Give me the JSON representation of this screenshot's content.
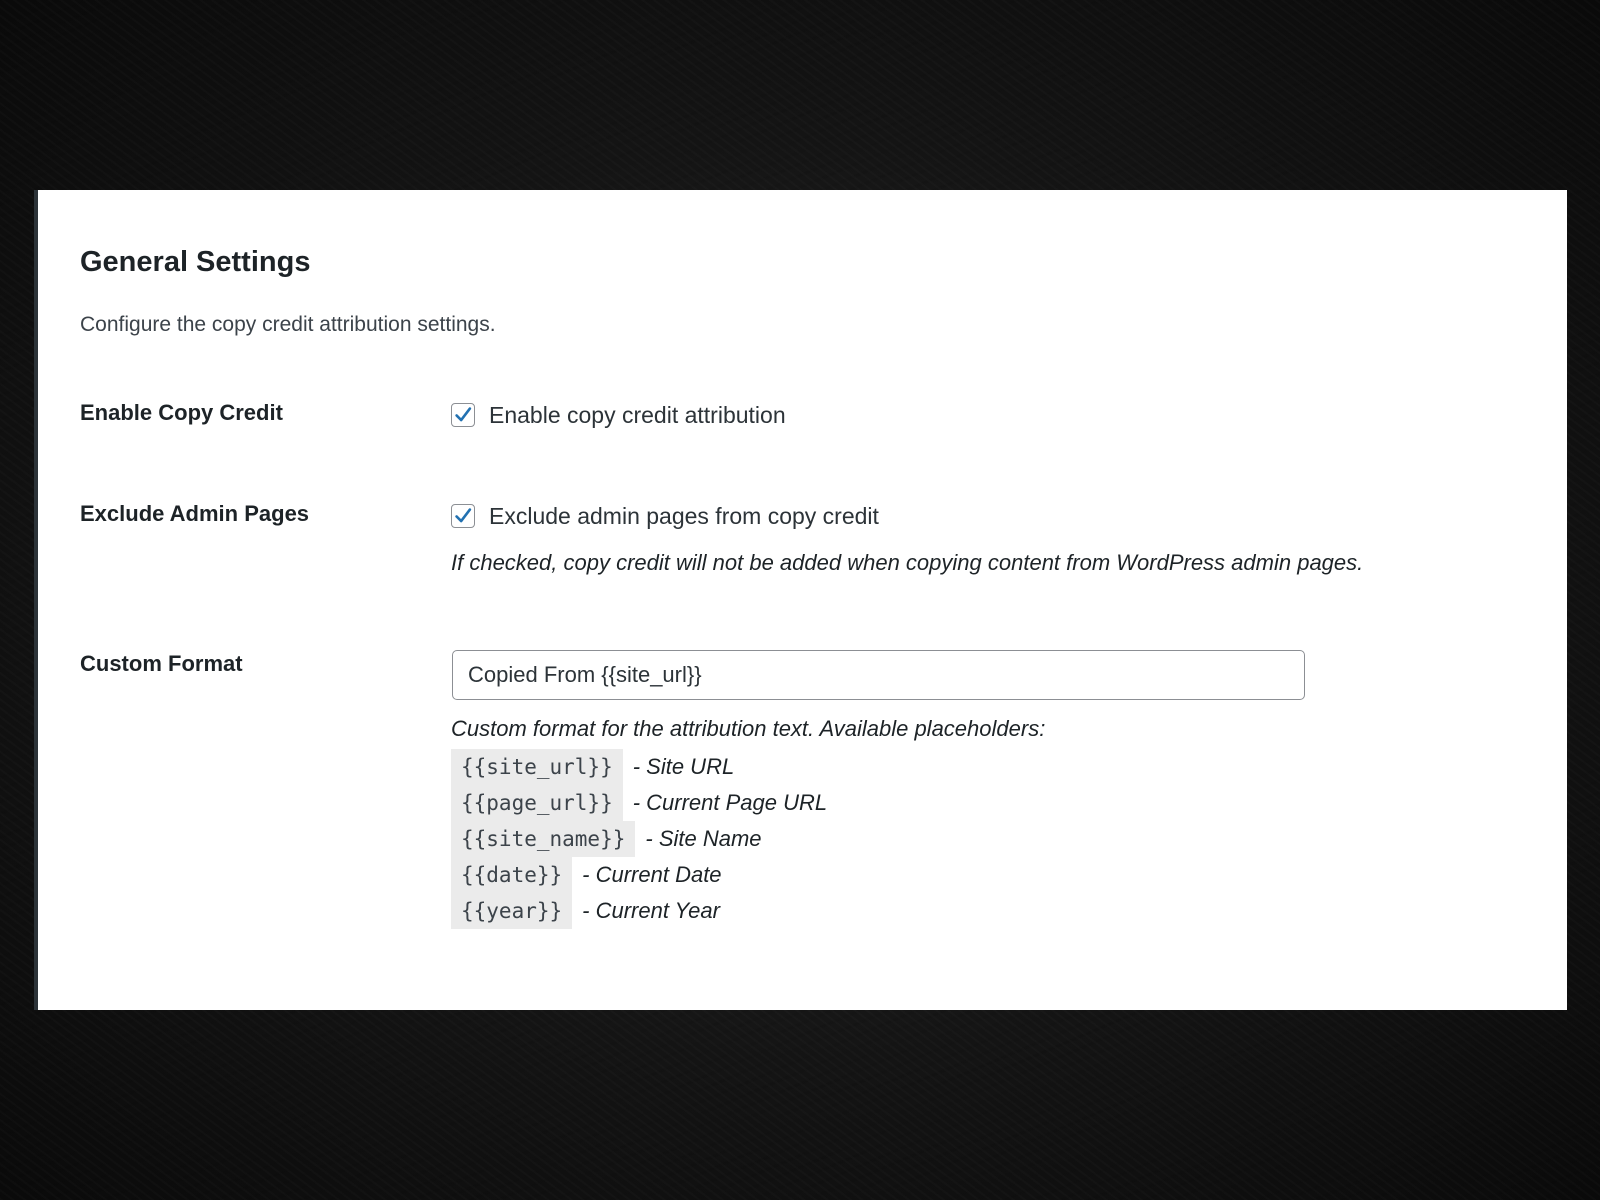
{
  "settings": {
    "title": "General Settings",
    "description": "Configure the copy credit attribution settings."
  },
  "enable_copy_credit": {
    "label": "Enable Copy Credit",
    "checkbox_label": "Enable copy credit attribution",
    "checked": true
  },
  "exclude_admin_pages": {
    "label": "Exclude Admin Pages",
    "checkbox_label": "Exclude admin pages from copy credit",
    "checked": true,
    "help": "If checked, copy credit will not be added when copying content from WordPress admin pages."
  },
  "custom_format": {
    "label": "Custom Format",
    "value": "Copied From {{site_url}}",
    "help": "Custom format for the attribution text. Available placeholders:",
    "placeholders": [
      {
        "code": "{{site_url}}",
        "desc": "- Site URL"
      },
      {
        "code": "{{page_url}}",
        "desc": "- Current Page URL"
      },
      {
        "code": "{{site_name}}",
        "desc": "- Site Name"
      },
      {
        "code": "{{date}}",
        "desc": "- Current Date"
      },
      {
        "code": "{{year}}",
        "desc": "- Current Year"
      }
    ]
  },
  "colors": {
    "checkbox_check": "#2271b1",
    "code_background": "#ebebeb",
    "heading_text": "#1d2327"
  }
}
